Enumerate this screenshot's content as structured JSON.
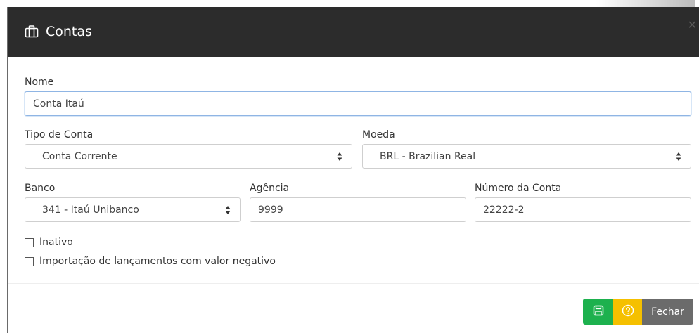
{
  "modal": {
    "title": "Contas",
    "title_icon": "briefcase-icon",
    "close_icon": "close-icon"
  },
  "form": {
    "nome": {
      "label": "Nome",
      "value": "Conta Itaú"
    },
    "tipo_conta": {
      "label": "Tipo de Conta",
      "value": "Conta Corrente"
    },
    "moeda": {
      "label": "Moeda",
      "value": "BRL - Brazilian Real"
    },
    "banco": {
      "label": "Banco",
      "value": "341 - Itaú Unibanco"
    },
    "agencia": {
      "label": "Agência",
      "value": "9999"
    },
    "numero_conta": {
      "label": "Número da Conta",
      "value": "22222-2"
    },
    "inativo": {
      "label": "Inativo",
      "checked": false
    },
    "importacao": {
      "label": "Importação de lançamentos com valor negativo",
      "checked": false
    }
  },
  "footer": {
    "save_icon": "save-icon",
    "help_icon": "help-icon",
    "close_label": "Fechar",
    "colors": {
      "save": "#1db14e",
      "help": "#f5c000",
      "close": "#6b6b6b"
    }
  }
}
